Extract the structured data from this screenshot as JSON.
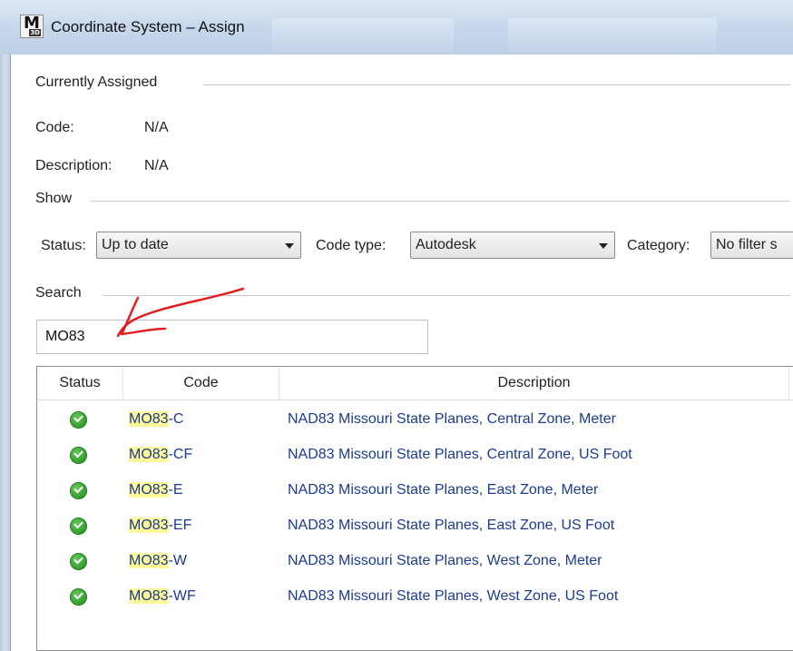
{
  "window": {
    "title": "Coordinate System – Assign",
    "icon_letter": "M",
    "icon_sub": "3D"
  },
  "currently_assigned": {
    "header": "Currently Assigned",
    "code_label": "Code:",
    "code_value": "N/A",
    "description_label": "Description:",
    "description_value": "N/A"
  },
  "show": {
    "header": "Show",
    "status_label": "Status:",
    "status_value": "Up to date",
    "code_type_label": "Code type:",
    "code_type_value": "Autodesk",
    "category_label": "Category:",
    "category_value": "No filter s"
  },
  "search": {
    "header": "Search",
    "value": "MO83"
  },
  "results": {
    "columns": [
      "Status",
      "Code",
      "Description"
    ],
    "rows": [
      {
        "code_match": "MO83",
        "code_rest": "-C",
        "description": "NAD83 Missouri State Planes, Central Zone, Meter"
      },
      {
        "code_match": "MO83",
        "code_rest": "-CF",
        "description": "NAD83 Missouri State Planes, Central Zone, US Foot"
      },
      {
        "code_match": "MO83",
        "code_rest": "-E",
        "description": "NAD83 Missouri State Planes, East Zone, Meter"
      },
      {
        "code_match": "MO83",
        "code_rest": "-EF",
        "description": "NAD83 Missouri State Planes, East Zone, US Foot"
      },
      {
        "code_match": "MO83",
        "code_rest": "-W",
        "description": "NAD83 Missouri State Planes, West Zone, Meter"
      },
      {
        "code_match": "MO83",
        "code_rest": "-WF",
        "description": "NAD83 Missouri State Planes, West Zone, US Foot"
      }
    ]
  },
  "colors": {
    "status_ok": "#2f9a2a",
    "code_highlight": "#fdf89a",
    "link_text": "#1b3b8f",
    "annotation": "#e02020"
  }
}
